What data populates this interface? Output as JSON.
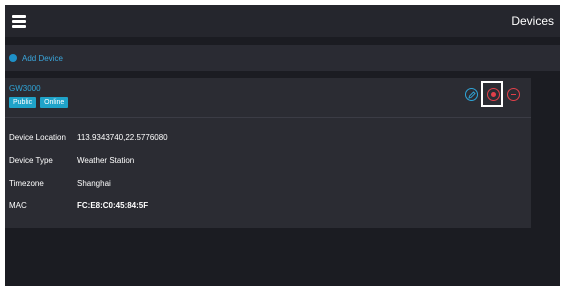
{
  "header": {
    "title": "Devices",
    "menu_icon": "hamburger-menu-icon"
  },
  "toolbar": {
    "add_label": "Add Device",
    "add_icon": "plus-circle-icon"
  },
  "device": {
    "name": "GW3000",
    "badges": [
      "Public",
      "Online"
    ],
    "actions": {
      "edit_icon": "pencil-icon",
      "stop_icon": "stop-record-icon",
      "remove_icon": "minus-circle-icon"
    },
    "fields": [
      {
        "label": "Device Location",
        "value": "113.9343740,22.5776080"
      },
      {
        "label": "Device Type",
        "value": "Weather Station"
      },
      {
        "label": "Timezone",
        "value": "Shanghai"
      },
      {
        "label": "MAC",
        "value": "FC:E8:C0:45:84:5F"
      }
    ]
  },
  "colors": {
    "accent": "#2fa5d8",
    "danger": "#e0404a",
    "badge": "#1fa3c9",
    "background": "#1b1c22",
    "card": "#2b2c33"
  }
}
